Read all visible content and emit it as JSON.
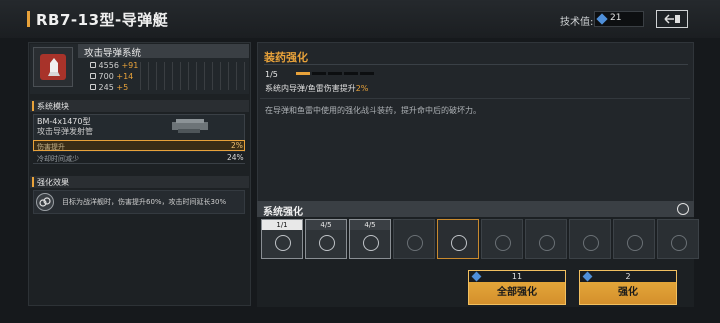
{
  "header": {
    "title": "RB7-13型-导弹艇",
    "tech_label": "技术值:",
    "tech_value": "21"
  },
  "weapon": {
    "name": "攻击导弹系统",
    "stats": [
      {
        "base": "4556",
        "bonus": "+91"
      },
      {
        "base": "700",
        "bonus": "+14"
      },
      {
        "base": "245",
        "bonus": "+5"
      }
    ]
  },
  "module_section": {
    "title": "系统模块",
    "name": "BM-4x1470型",
    "subtitle": "攻击导弹发射管",
    "rows": [
      {
        "label": "伤害提升",
        "value": "2%"
      },
      {
        "label": "冷却时间减少",
        "value": "24%"
      }
    ]
  },
  "effect_section": {
    "title": "强化效果",
    "text": "目标为战洋舰时，伤害提升60%，攻击时间延长30%"
  },
  "detail": {
    "title": "装药强化",
    "level_text": "1/5",
    "level_current": 1,
    "level_max": 5,
    "desc_prefix": "系统内导弹/鱼雷伤害提升",
    "desc_pct": "2%",
    "description": "在导弹和鱼雷中使用的强化战斗装药，提升命中后的破坏力。"
  },
  "system_enhance": {
    "title": "系统强化",
    "slots": [
      {
        "label": "1/1",
        "icon": "shell-icon",
        "state": "owned"
      },
      {
        "label": "4/5",
        "icon": "shell-icon",
        "state": "owned"
      },
      {
        "label": "4/5",
        "icon": "wrench-icon",
        "state": "owned"
      },
      {
        "label": "",
        "icon": "missile-icon",
        "state": "locked"
      },
      {
        "label": "",
        "icon": "missile-icon",
        "state": "active"
      },
      {
        "label": "",
        "icon": "radar-icon",
        "state": "locked"
      },
      {
        "label": "",
        "icon": "burst-icon",
        "state": "locked"
      },
      {
        "label": "",
        "icon": "burst-icon",
        "state": "locked"
      },
      {
        "label": "",
        "icon": "burst-icon",
        "state": "locked"
      },
      {
        "label": "",
        "icon": "missile-icon",
        "state": "locked"
      }
    ]
  },
  "buttons": {
    "enhance_all": {
      "cost": "11",
      "label": "全部强化"
    },
    "enhance": {
      "cost": "2",
      "label": "强化"
    }
  },
  "colors": {
    "accent": "#e8a23a",
    "gem": "#4f8fd9",
    "background": "#16191c"
  }
}
